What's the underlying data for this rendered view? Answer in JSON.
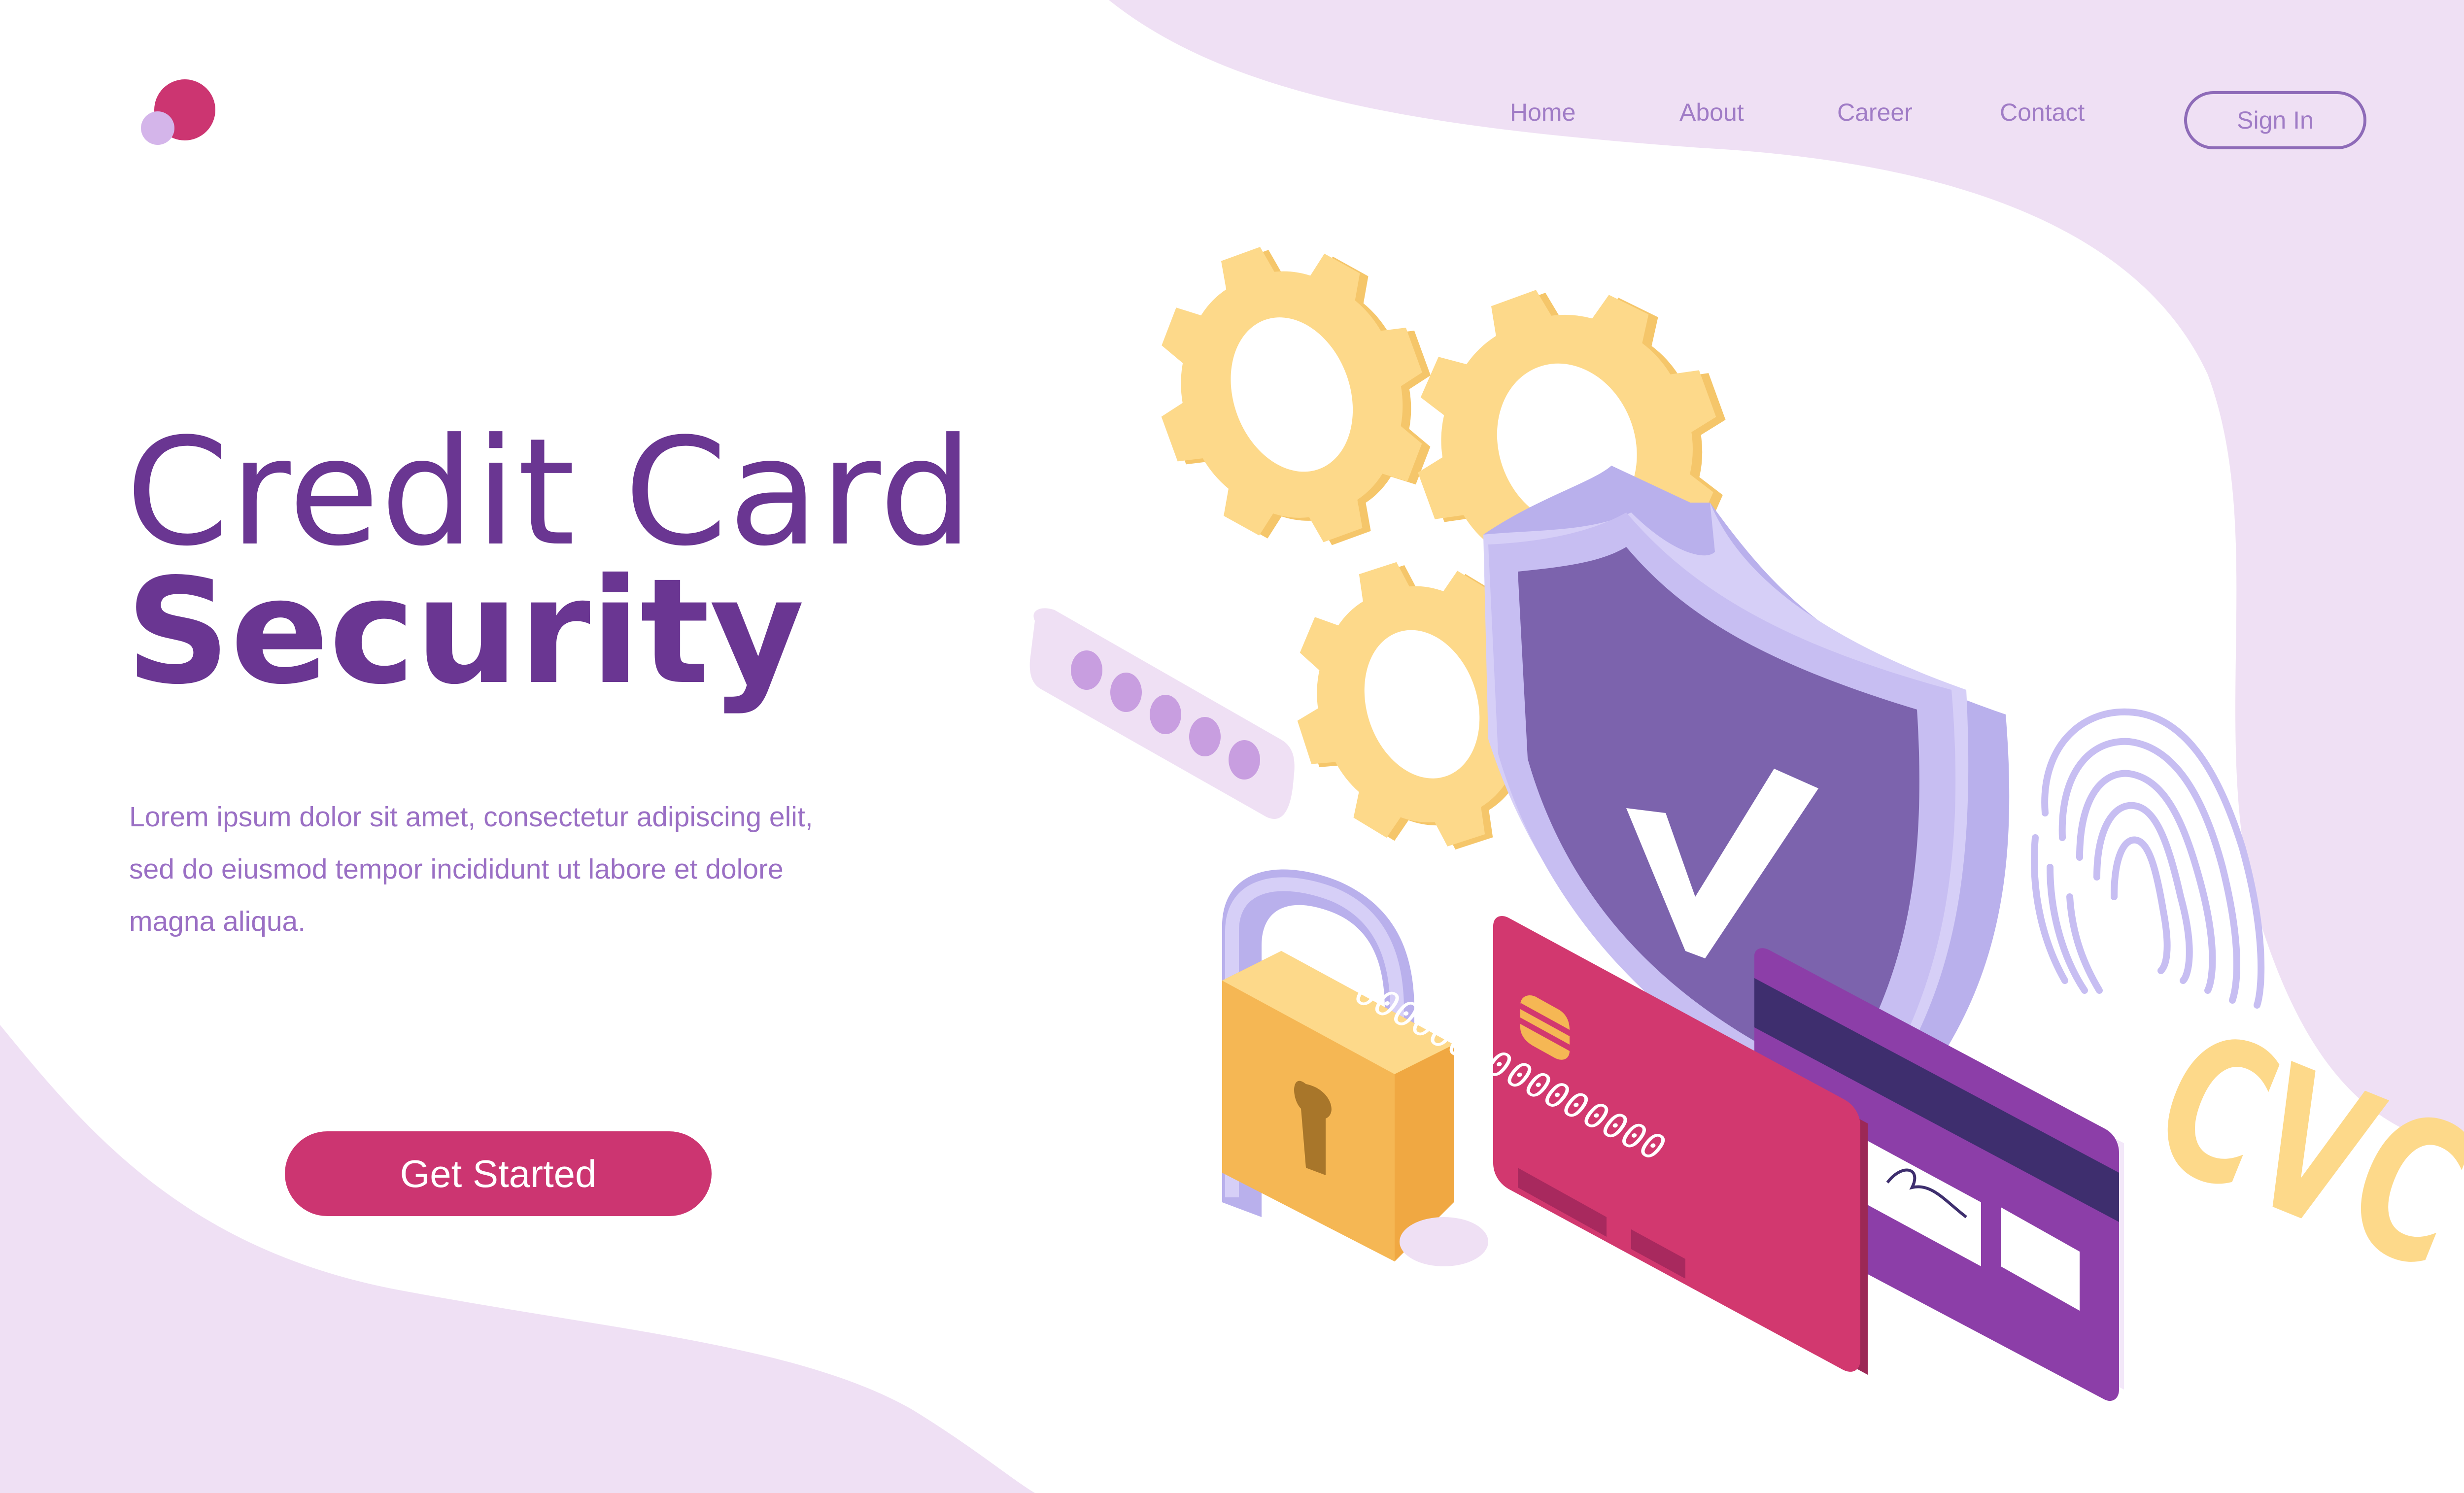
{
  "nav": {
    "items": [
      "Home",
      "About",
      "Career",
      "Contact"
    ],
    "signin_label": "Sign In"
  },
  "hero": {
    "title_line1": "Credit Card",
    "title_line2": "Security",
    "description_lines": [
      "Lorem ipsum dolor sit amet, consectetur adipiscing elit,",
      "sed do eiusmod tempor incididunt ut labore et dolore",
      "magna aliqua."
    ],
    "cta_label": "Get Started"
  },
  "illustration": {
    "card_numbers": [
      "0000",
      "0000",
      "0000",
      "0000"
    ],
    "cvc_label": "CVC",
    "password_mask_dots": 5
  },
  "icons": [
    "logo-icon",
    "gear-icon",
    "shield-check-icon",
    "padlock-icon",
    "credit-card-icon",
    "fingerprint-icon",
    "password-field-icon"
  ],
  "colors": {
    "primary_purple": "#6a3692",
    "nav_text": "#a07cc6",
    "cta_pink": "#cc3571",
    "background_blob": "#efe0f4",
    "gear_yellow": "#fdd98a",
    "shield_purple": "#7c63ad"
  }
}
